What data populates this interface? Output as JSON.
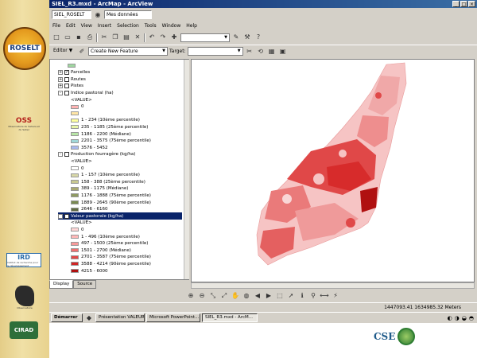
{
  "window": {
    "title": "SIEL_R3.mxd - ArcMap - ArcView",
    "controls": [
      "_",
      "□",
      "×"
    ]
  },
  "docbar": {
    "project": "SIEL_ROSELT",
    "legend_label": "Mes données"
  },
  "menus": [
    "File",
    "Edit",
    "View",
    "Insert",
    "Selection",
    "Tools",
    "Window",
    "Help"
  ],
  "toolbar": {
    "scale_value": ""
  },
  "editor": {
    "label": "Editor ▼",
    "task_label": "Create New Feature",
    "target_label": "Target:"
  },
  "toc": {
    "items": [
      {
        "label": "",
        "swatch": "#9fd7a0",
        "indent": 22
      },
      {
        "label": "Parcelles",
        "expander": "+",
        "checkbox": "✓",
        "indent": 10
      },
      {
        "label": "Routes",
        "expander": "+",
        "checkbox": "",
        "indent": 10
      },
      {
        "label": "Pistes",
        "expander": "+",
        "checkbox": "",
        "indent": 10
      },
      {
        "label": "Indice pastoral (ha)",
        "expander": "-",
        "checkbox": "",
        "indent": 10
      },
      {
        "label": "<VALUE>",
        "indent": 26
      },
      {
        "label": "0",
        "swatch": "#ffb3b3",
        "indent": 26
      },
      {
        "label": "",
        "swatch": "#ffe6a6",
        "indent": 26
      },
      {
        "label": "1 - 234   (10ème percentile)",
        "swatch": "#ffff9e",
        "indent": 26
      },
      {
        "label": "235 - 1185   (25ème percentile)",
        "swatch": "#e8f5a8",
        "indent": 26
      },
      {
        "label": "1186 - 2200   (Médiane)",
        "swatch": "#b8e6a6",
        "indent": 26
      },
      {
        "label": "2201 - 3575   (75ème percentile)",
        "swatch": "#9fd7d8",
        "indent": 26
      },
      {
        "label": "3576 - 5452",
        "swatch": "#a9b9ee",
        "indent": 26
      },
      {
        "label": "Production fourragère (kg/ha)",
        "expander": "-",
        "checkbox": "",
        "indent": 10
      },
      {
        "label": "<VALUE>",
        "indent": 26
      },
      {
        "label": "0",
        "swatch": "#ffffff",
        "indent": 26
      },
      {
        "label": "1 - 157   (10ème percentile)",
        "swatch": "#d8d8a8",
        "indent": 26
      },
      {
        "label": "158 - 388   (25ème percentile)",
        "swatch": "#c8c890",
        "indent": 26
      },
      {
        "label": "389 - 1175   (Médiane)",
        "swatch": "#a8a870",
        "indent": 26
      },
      {
        "label": "1176 - 1888   (75ème percentile)",
        "swatch": "#8f9a62",
        "indent": 26
      },
      {
        "label": "1889 - 2645   (90ème percentile)",
        "swatch": "#7a8a52",
        "indent": 26
      },
      {
        "label": "2646 - 6160",
        "swatch": "#606a42",
        "indent": 26
      },
      {
        "label": "Valeur pastorale (kg/ha)",
        "expander": "-",
        "checkbox": "✓",
        "indent": 10,
        "selected": true
      },
      {
        "label": "<VALUE>",
        "indent": 26
      },
      {
        "label": "0",
        "swatch": "#ffd6d6",
        "indent": 26
      },
      {
        "label": "1 - 496   (10ème percentile)",
        "swatch": "#ffb8b8",
        "indent": 26
      },
      {
        "label": "497 - 1500   (25ème percentile)",
        "swatch": "#f79a9a",
        "indent": 26
      },
      {
        "label": "1501 - 2700   (Médiane)",
        "swatch": "#ef7070",
        "indent": 26
      },
      {
        "label": "2701 - 3587   (75ème percentile)",
        "swatch": "#e34848",
        "indent": 26
      },
      {
        "label": "3588 - 4214   (90ème percentile)",
        "swatch": "#d02525",
        "indent": 26
      },
      {
        "label": "4215 - 6000",
        "swatch": "#b01010",
        "indent": 26
      }
    ]
  },
  "tabs": [
    "Display",
    "Source"
  ],
  "status": {
    "text": "",
    "coordinates": "1447093.41  1634985.32 Meters"
  },
  "taskbar": {
    "start_label": "Démarrer",
    "tasks": [
      "Présentation VALEUR...",
      "Microsoft PowerPoint...",
      "SIEL_R3.mxd - ArcM..."
    ],
    "active_task": 2
  },
  "colors": {
    "map_light": "#f6c4c4",
    "map_mid": "#ee8e8e",
    "map_dark": "#d72b2b",
    "map_darkest": "#b01010"
  },
  "logos": {
    "roselt": "ROSELT",
    "oss": "OSS",
    "oss_sub": "Observatoire du Sahara et du Sahel",
    "ird": "IRD",
    "ird_sub": "Institut de recherche pour le développement",
    "africa_sub": "Observatoire",
    "cirad": "CIRAD",
    "cse": "CSE"
  }
}
